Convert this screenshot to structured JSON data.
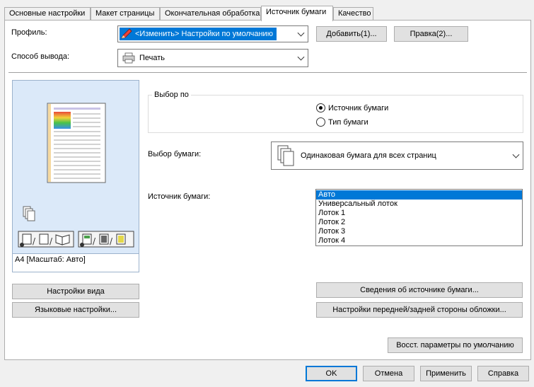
{
  "tabs": [
    {
      "label": "Основные настройки",
      "active": false
    },
    {
      "label": "Макет страницы",
      "active": false
    },
    {
      "label": "Окончательная обработка",
      "active": false
    },
    {
      "label": "Источник бумаги",
      "active": true
    },
    {
      "label": "Качество",
      "active": false
    }
  ],
  "profile": {
    "label": "Профиль:",
    "value": "<Изменить> Настройки по умолчанию",
    "add_button": "Добавить(1)...",
    "edit_button": "Правка(2)..."
  },
  "output": {
    "label": "Способ вывода:",
    "value": "Печать"
  },
  "preview": {
    "caption": "A4 [Масштаб: Авто]"
  },
  "select_by": {
    "group_label": "Выбор по",
    "options": [
      {
        "label": "Источник бумаги",
        "selected": true
      },
      {
        "label": "Тип бумаги",
        "selected": false
      }
    ]
  },
  "paper_selection": {
    "label": "Выбор бумаги:",
    "value": "Одинаковая бумага для всех страниц"
  },
  "paper_source": {
    "label": "Источник бумаги:",
    "items": [
      "Авто",
      "Универсальный лоток",
      "Лоток 1",
      "Лоток 2",
      "Лоток 3",
      "Лоток 4"
    ],
    "selected_index": 0
  },
  "left_buttons": {
    "view_settings": "Настройки вида",
    "language_settings": "Языковые настройки..."
  },
  "right_buttons": {
    "source_info": "Сведения об источнике бумаги...",
    "cover_settings": "Настройки передней/задней стороны обложки...",
    "restore_defaults": "Восст. параметры по умолчанию"
  },
  "footer": {
    "ok": "OK",
    "cancel": "Отмена",
    "apply": "Применить",
    "help": "Справка"
  },
  "colors": {
    "accent": "#0078d7",
    "preview_bg": "#dbe9f9"
  }
}
